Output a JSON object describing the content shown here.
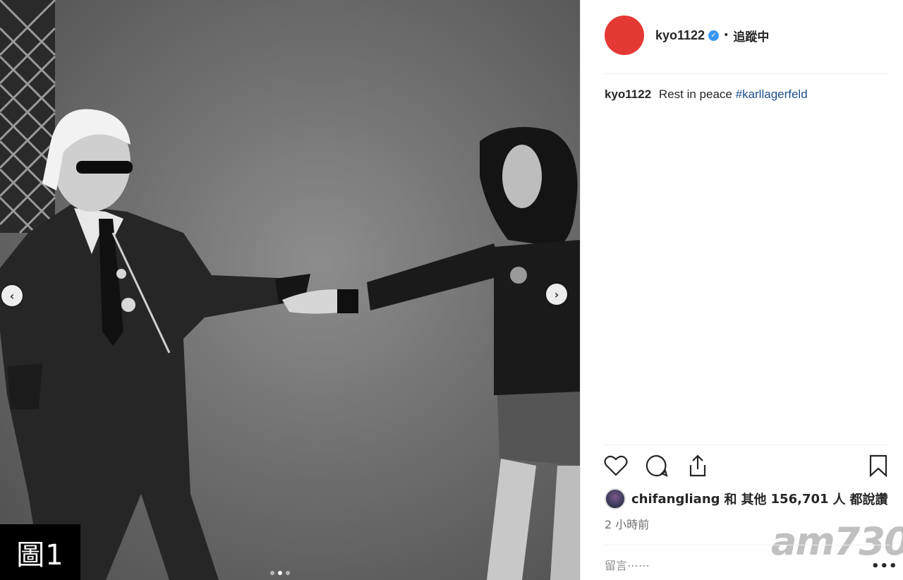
{
  "figure_label": "圖1",
  "carousel": {
    "prev_icon": "chevron-left-icon",
    "next_icon": "chevron-right-icon",
    "total_slides": 3,
    "active_slide": 2
  },
  "post": {
    "username": "kyo1122",
    "verified": true,
    "bullet": "•",
    "follow_status": "追蹤中",
    "avatar_color": "#e53935",
    "caption": {
      "username": "kyo1122",
      "text": "Rest in peace",
      "hashtag": "#karllagerfeld"
    },
    "likes": {
      "user": "chifangliang",
      "joiner": "和",
      "others_label": "其他",
      "count": "156,701",
      "unit": "人",
      "suffix": "都說讚"
    },
    "timestamp": "2 小時前",
    "comment_placeholder": "留言⋯⋯",
    "more_label": "•••"
  },
  "watermark": "am730",
  "colors": {
    "hashtag": "#1c4f8c",
    "verified": "#3897f0"
  }
}
